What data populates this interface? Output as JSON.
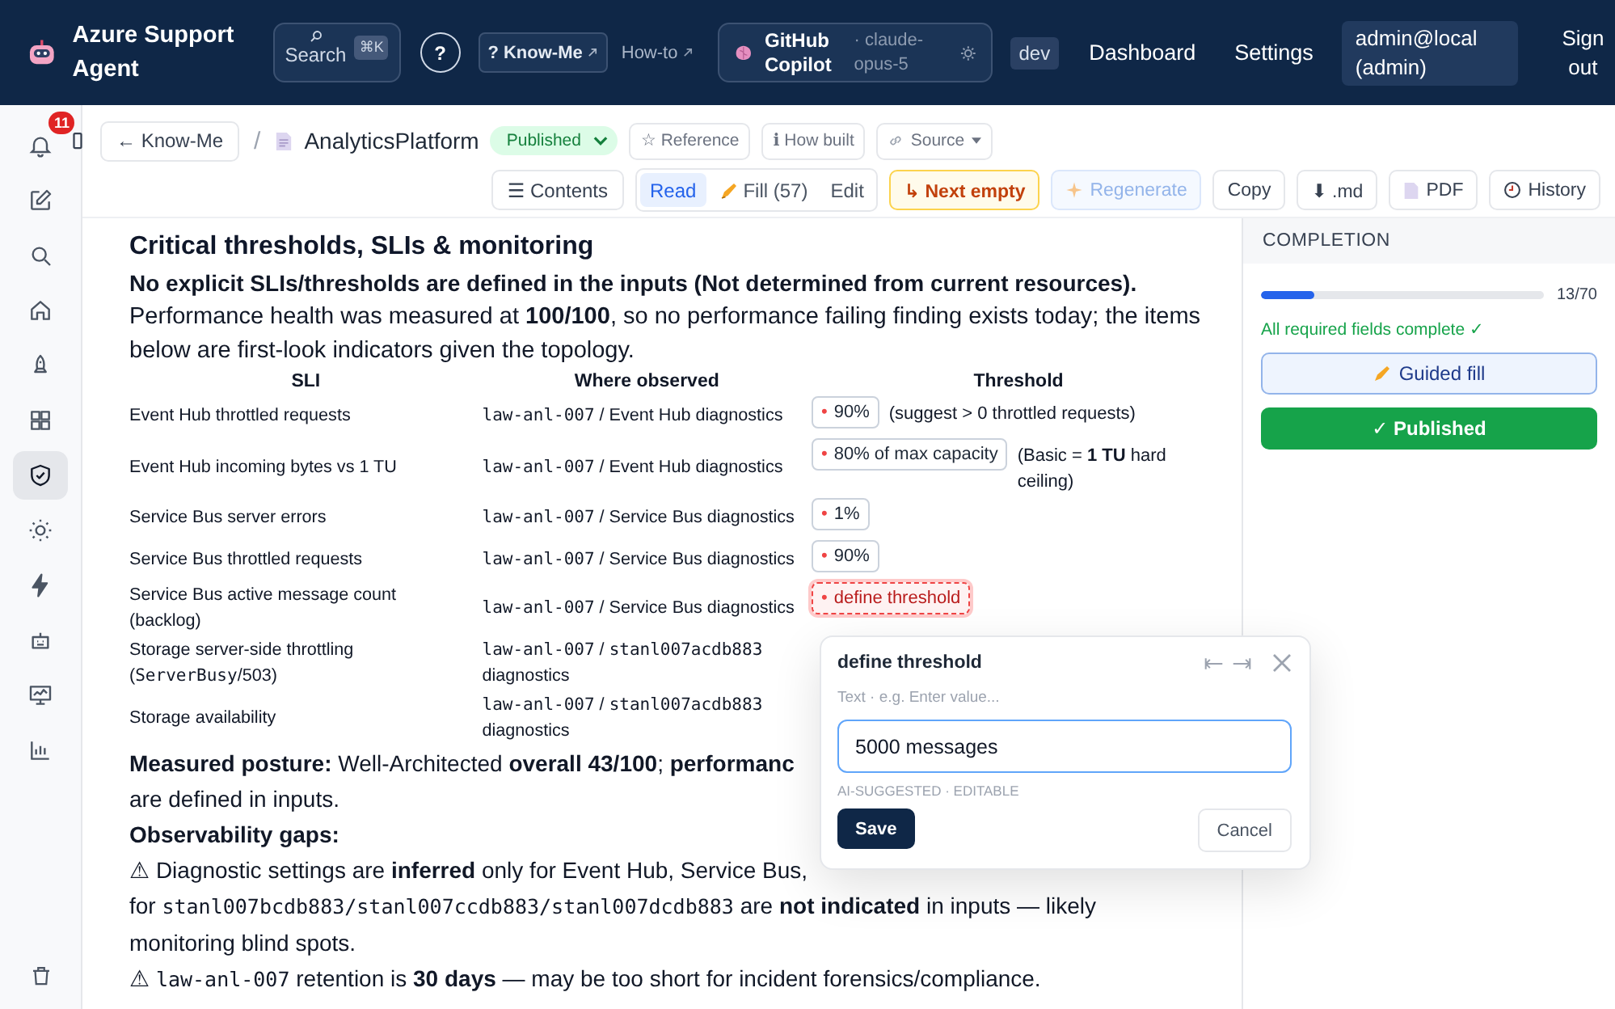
{
  "app": {
    "title": "Azure Support Agent"
  },
  "topbar": {
    "search": {
      "label": "Search",
      "shortcut": "⌘K"
    },
    "help": "?",
    "know_me": "? Know-Me",
    "how_to": "How-to",
    "copilot": {
      "name": "GitHub Copilot",
      "model": "· claude-opus-5"
    },
    "env": "dev",
    "nav": [
      "Dashboard",
      "Settings"
    ],
    "user": "admin@local (admin)",
    "sign_out": "Sign out"
  },
  "sidebar": {
    "badge": "11",
    "items": [
      {
        "selected": false
      },
      {
        "selected": false
      },
      {
        "selected": false
      },
      {
        "selected": false
      },
      {
        "selected": false
      },
      {
        "selected": true
      },
      {
        "selected": false
      },
      {
        "selected": false
      },
      {
        "selected": false
      },
      {
        "selected": false
      },
      {
        "selected": false
      }
    ]
  },
  "breadcrumb": {
    "back": "← Know-Me",
    "separator": "/",
    "document": "AnalyticsPlatform",
    "status": "Published",
    "actions": [
      "☆ Reference",
      "ℹ How built",
      "Source"
    ]
  },
  "toolbar": {
    "contents": "☰ Contents",
    "modes": [
      {
        "label": "Read",
        "selected": true
      },
      {
        "label": "Fill (57)",
        "selected": false
      },
      {
        "label": "Edit",
        "selected": false
      }
    ],
    "actions": [
      {
        "label": "↳ Next empty",
        "kind": "warning"
      },
      {
        "label": "Regenerate",
        "kind": "ai"
      },
      {
        "label": "Copy",
        "kind": "plain"
      },
      {
        "label": "⬇ .md",
        "kind": "plain"
      },
      {
        "label": "PDF",
        "kind": "pdf"
      },
      {
        "label": "History",
        "kind": "history"
      }
    ]
  },
  "section": {
    "title": "Critical thresholds, SLIs & monitoring",
    "lead": "No explicit SLIs/thresholds are defined in the inputs (Not determined from current resources).",
    "intro": "Performance health was measured at **100/100**, so no performance failing finding exists today; the items below are first-look indicators given the topology.",
    "table": {
      "columns": [
        "SLI",
        "Where observed",
        "Threshold"
      ],
      "rows": [
        {
          "sli": [
            {
              "text": "Event Hub throttled requests",
              "kind": "text"
            }
          ],
          "where": [
            {
              "text": "law-anl-007",
              "kind": "mono"
            },
            {
              "text": " / Event Hub diagnostics",
              "kind": "text"
            }
          ],
          "threshold": {
            "marker": "•",
            "value": "90%",
            "defined": true
          },
          "note": "(suggest > 0 throttled requests)"
        },
        {
          "sli": [
            {
              "text": "Event Hub incoming bytes vs 1 TU",
              "kind": "text"
            }
          ],
          "where": [
            {
              "text": "law-anl-007",
              "kind": "mono"
            },
            {
              "text": " / Event Hub diagnostics",
              "kind": "text"
            }
          ],
          "threshold": {
            "marker": "•",
            "value": "80% of max capacity",
            "defined": true
          },
          "note": "(Basic = **1 TU** hard ceiling)"
        },
        {
          "sli": [
            {
              "text": "Service Bus server errors",
              "kind": "text"
            }
          ],
          "where": [
            {
              "text": "law-anl-007",
              "kind": "mono"
            },
            {
              "text": " / Service Bus diagnostics",
              "kind": "text"
            }
          ],
          "threshold": {
            "marker": "•",
            "value": "1%",
            "defined": true
          }
        },
        {
          "sli": [
            {
              "text": "Service Bus throttled requests",
              "kind": "text"
            }
          ],
          "where": [
            {
              "text": "law-anl-007",
              "kind": "mono"
            },
            {
              "text": " / Service Bus diagnostics",
              "kind": "text"
            }
          ],
          "threshold": {
            "marker": "•",
            "value": "90%",
            "defined": true
          }
        },
        {
          "sli": [
            {
              "text": "Service Bus active message count (backlog)",
              "kind": "text"
            }
          ],
          "where": [
            {
              "text": "law-anl-007",
              "kind": "mono"
            },
            {
              "text": " / Service Bus diagnostics",
              "kind": "text"
            }
          ],
          "threshold": {
            "marker": "•",
            "value": "define threshold",
            "defined": false
          }
        },
        {
          "sli": [
            {
              "text": "Storage server-side throttling (",
              "kind": "text"
            },
            {
              "text": "ServerBusy",
              "kind": "mono"
            },
            {
              "text": "/503)",
              "kind": "text"
            }
          ],
          "where": [
            {
              "text": "law-anl-007",
              "kind": "mono"
            },
            {
              "text": " / ",
              "kind": "text"
            },
            {
              "text": "stanl007acdb883",
              "kind": "mono"
            },
            {
              "text": " diagnostics",
              "kind": "text"
            }
          ]
        },
        {
          "sli": [
            {
              "text": "Storage availability",
              "kind": "text"
            }
          ],
          "where": [
            {
              "text": "law-anl-007",
              "kind": "mono"
            },
            {
              "text": " / ",
              "kind": "text"
            },
            {
              "text": "stanl007acdb883",
              "kind": "mono"
            },
            {
              "text": " diagnostics",
              "kind": "text"
            }
          ]
        }
      ]
    },
    "lines": [
      [
        {
          "text": "**Measured posture:** Well-Architected **overall 43/100**; **performanc**",
          "kind": "text"
        }
      ],
      [
        {
          "text": "are defined in inputs.",
          "kind": "text"
        }
      ],
      [
        {
          "text": "**Observability gaps:**",
          "kind": "text"
        }
      ],
      [
        {
          "text": "⚠ Diagnostic settings are **inferred** only for Event Hub, Service Bus,",
          "kind": "text"
        }
      ],
      [
        {
          "text": "for ",
          "kind": "text"
        },
        {
          "text": "stanl007bcdb883/stanl007ccdb883/stanl007dcdb883",
          "kind": "mono"
        },
        {
          "text": " are **not indicated** in inputs — likely",
          "kind": "text"
        }
      ],
      [
        {
          "text": "monitoring blind spots.",
          "kind": "text"
        }
      ],
      [
        {
          "text": "⚠ ",
          "kind": "text"
        },
        {
          "text": "law-anl-007",
          "kind": "mono"
        },
        {
          "text": " retention is **30 days** — may be too short for incident forensics/compliance.",
          "kind": "text"
        }
      ]
    ]
  },
  "popover": {
    "title": "define threshold",
    "hint": "Text · e.g. Enter value...",
    "value": "5000 messages",
    "note": "AI-SUGGESTED · EDITABLE",
    "save": "Save",
    "cancel": "Cancel"
  },
  "completion": {
    "title": "COMPLETION",
    "level": 0.186,
    "count": "13/70",
    "status": "All required fields complete ✓",
    "guided": "Guided fill",
    "published": "✓ Published"
  }
}
